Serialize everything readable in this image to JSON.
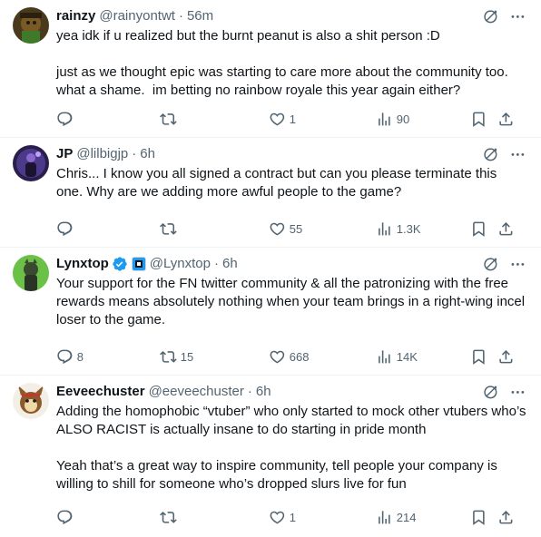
{
  "tweets": [
    {
      "name": "rainzy",
      "handle": "@rainyontwt",
      "dot": "·",
      "time": "56m",
      "text": "yea idk if u realized but the burnt peanut is also a shit person :D\n\njust as we thought epic was starting to care more about the community too. what a shame.  im betting no rainbow royale this year again either?",
      "replies": "",
      "retweets": "",
      "likes": "1",
      "views": "90"
    },
    {
      "name": "JP",
      "handle": "@lilbigjp",
      "dot": "·",
      "time": "6h",
      "text": "Chris... I know you all signed a contract but can you please terminate this one. Why are we adding more awful people to the game?",
      "replies": "",
      "retweets": "",
      "likes": "55",
      "views": "1.3K"
    },
    {
      "name": "Lynxtop",
      "handle": "@Lynxtop",
      "dot": "·",
      "time": "6h",
      "text": "Your support for the FN twitter community & all the patronizing with the free rewards means absolutely nothing when your team brings in a right-wing incel loser to the game.",
      "replies": "8",
      "retweets": "15",
      "likes": "668",
      "views": "14K"
    },
    {
      "name": "Eeveechuster",
      "handle": "@eeveechuster",
      "dot": "·",
      "time": "6h",
      "text": "Adding the homophobic “vtuber” who only started to mock other vtubers who’s ALSO RACIST is actually insane to do starting in pride month\n\nYeah that’s a great way to inspire community, tell people your company is willing to shill for someone who’s dropped slurs live for fun",
      "replies": "",
      "retweets": "",
      "likes": "1",
      "views": "214"
    }
  ],
  "colors": {
    "text": "#0f1419",
    "secondary": "#536471",
    "verified": "#1d9bf0",
    "divider": "#eff3f4"
  }
}
